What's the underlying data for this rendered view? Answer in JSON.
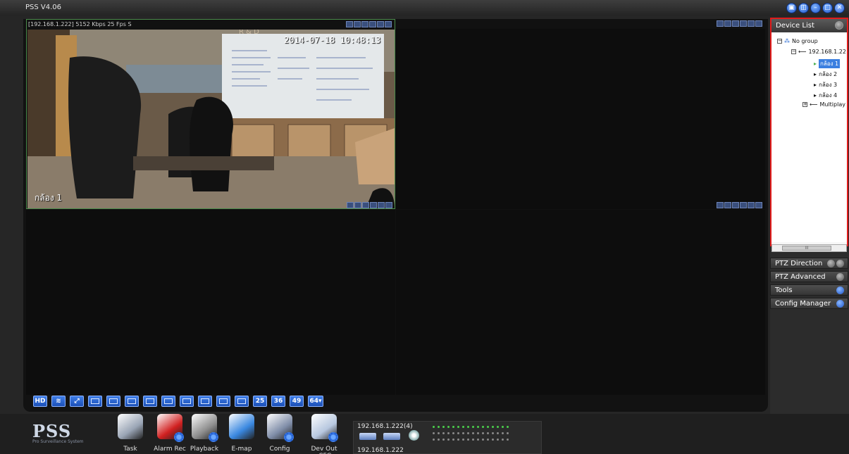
{
  "app": {
    "title": "PSS  V4.06"
  },
  "window_controls": [
    {
      "name": "minimize-to-tray",
      "glyph": "▣"
    },
    {
      "name": "restore",
      "glyph": "◫"
    },
    {
      "name": "minimize",
      "glyph": "–"
    },
    {
      "name": "maximize",
      "glyph": "□"
    },
    {
      "name": "close",
      "glyph": "✕"
    }
  ],
  "video": {
    "tile1_info": "[192.168.1.222] 5152 Kbps 25 Fps S",
    "osd_time": "2014-07-18 10:48:13",
    "osd_camera": "กล้อง 1",
    "whiteboard_header": "R & D"
  },
  "layout_bar": {
    "hd": "HD",
    "counts": [
      "25",
      "36",
      "49",
      "64▾"
    ]
  },
  "side": {
    "device_list": "Device List",
    "tree": {
      "group": "No group",
      "device": "192.168.1.22",
      "cams": [
        "กล้อง 1",
        "กล้อง 2",
        "กล้อง 3",
        "กล้อง 4"
      ],
      "multiplay": "Multiplay"
    },
    "scroll_glyph": "III",
    "ptz_direction": "PTZ Direction",
    "ptz_advanced": "PTZ Advanced",
    "tools": "Tools",
    "config_manager": "Config Manager"
  },
  "bottom": {
    "brand": "PSS",
    "brand_sub": "Pro Surveillance System",
    "tools": [
      {
        "id": "task",
        "label": "Task",
        "color": "#9aa5b5"
      },
      {
        "id": "alarm-rec",
        "label": "Alarm Rec",
        "color": "#d12020"
      },
      {
        "id": "playback",
        "label": "Playback",
        "color": "#8e8e8e"
      },
      {
        "id": "e-map",
        "label": "E-map",
        "color": "#3a88e0"
      },
      {
        "id": "config",
        "label": "Config",
        "color": "#7f8da8"
      },
      {
        "id": "dev-out-cfg",
        "label": "Dev Out .CFG",
        "color": "#b7c7df"
      }
    ],
    "status_ip_top": "192.168.1.222(4)",
    "status_ip_bottom": "192.168.1.222",
    "led_on": "#4bd04b",
    "led_off": "#8a8a8a"
  }
}
